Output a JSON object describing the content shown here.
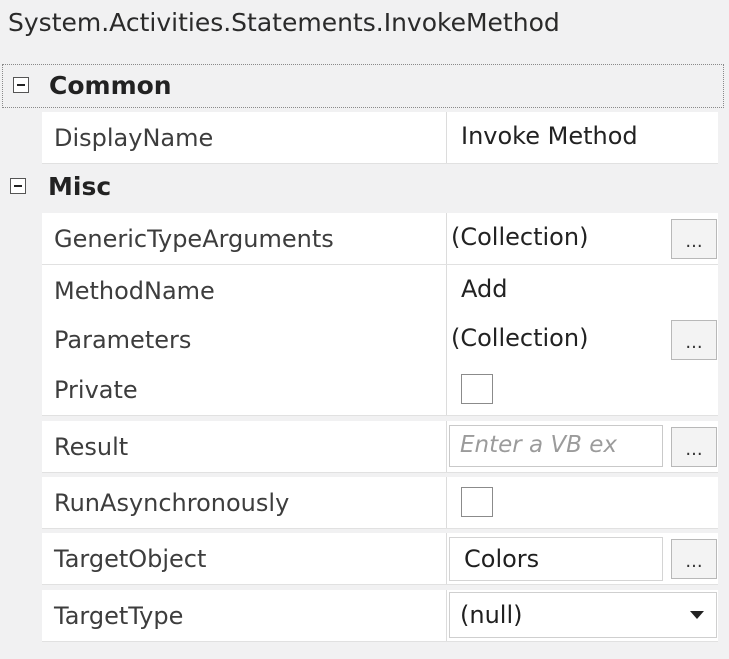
{
  "header": {
    "title": "System.Activities.Statements.InvokeMethod"
  },
  "categories": {
    "common": {
      "label": "Common"
    },
    "misc": {
      "label": "Misc"
    }
  },
  "properties": {
    "display_name": {
      "name": "DisplayName",
      "value": "Invoke Method"
    },
    "generic_type_arguments": {
      "name": "GenericTypeArguments",
      "value": "(Collection)",
      "button": "..."
    },
    "method_name": {
      "name": "MethodName",
      "value": "Add"
    },
    "parameters": {
      "name": "Parameters",
      "value": "(Collection)",
      "button": "..."
    },
    "private": {
      "name": "Private",
      "checked": false
    },
    "result": {
      "name": "Result",
      "placeholder": "Enter a VB ex",
      "button": "..."
    },
    "run_asynchronously": {
      "name": "RunAsynchronously",
      "checked": false
    },
    "target_object": {
      "name": "TargetObject",
      "value": "Colors",
      "button": "..."
    },
    "target_type": {
      "name": "TargetType",
      "value": "(null)"
    }
  },
  "icons": {
    "collapse": "minus-box-icon",
    "dropdown": "triangle-down-icon"
  }
}
